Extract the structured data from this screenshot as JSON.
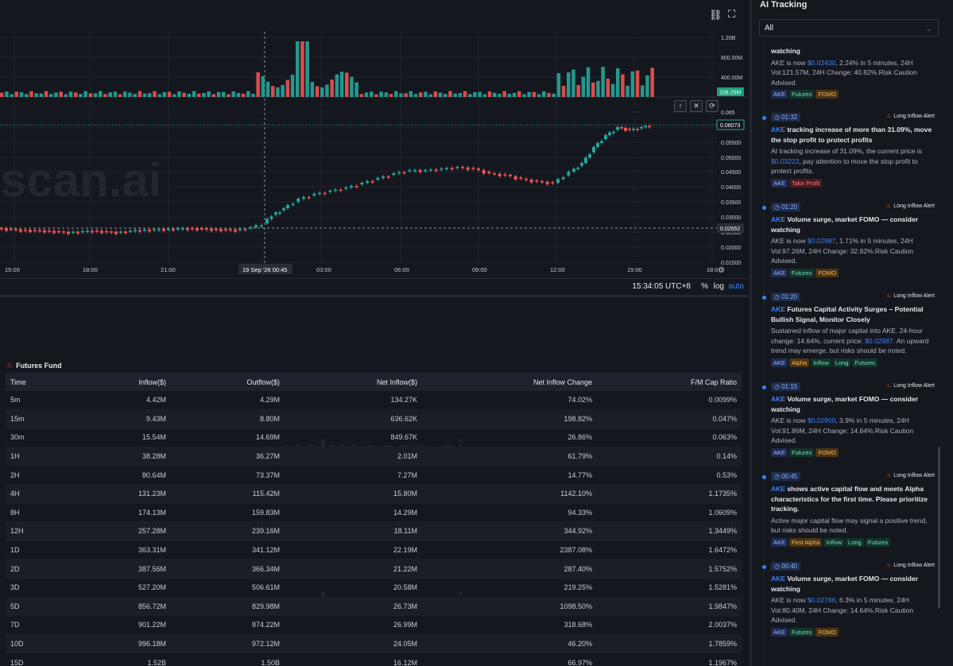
{
  "chart": {
    "volume_scale": [
      "1.20B",
      "800.00M",
      "400.00M"
    ],
    "volume_current": "108.25M",
    "price_scale": [
      "0.065",
      "0.05500",
      "0.05000",
      "0.04500",
      "0.04000",
      "0.03500",
      "0.03000",
      "0.02500",
      "0.02000",
      "0.01500"
    ],
    "last_price": "0.06073",
    "crosshair_price": "0.02652",
    "time_labels": [
      "15:00",
      "18:00",
      "21:00",
      "03:00",
      "06:00",
      "09:00",
      "12:00",
      "15:00",
      "18:0"
    ],
    "crosshair_time": "19 Sep '26   00:45",
    "clock": "15:34:05 UTC+8",
    "pct_label": "%",
    "log_label": "log",
    "auto_label": "auto",
    "watermark": "scan.ai",
    "colors": {
      "up": "#26a69a",
      "down": "#ef5350",
      "accent": "#3b82f6"
    }
  },
  "fund": {
    "title": "Futures Fund",
    "columns": [
      "Time",
      "Inflow($)",
      "Outflow($)",
      "Net Inflow($)",
      "Net Inflow Change",
      "F/M Cap Ratio"
    ],
    "watermark": "valuescan.ai",
    "rows": [
      {
        "time": "5m",
        "inflow": "4.42M",
        "outflow": "4.29M",
        "net": "134.27K",
        "change": "74.02%",
        "change_dir": "neg",
        "ratio": "0.0099%"
      },
      {
        "time": "15m",
        "inflow": "9.43M",
        "outflow": "8.80M",
        "net": "636.62K",
        "change": "198.82%",
        "change_dir": "pos",
        "ratio": "0.047%"
      },
      {
        "time": "30m",
        "inflow": "15.54M",
        "outflow": "14.69M",
        "net": "849.67K",
        "change": "26.86%",
        "change_dir": "neg",
        "ratio": "0.063%"
      },
      {
        "time": "1H",
        "inflow": "38.28M",
        "outflow": "36.27M",
        "net": "2.01M",
        "change": "61.79%",
        "change_dir": "neg",
        "ratio": "0.14%"
      },
      {
        "time": "2H",
        "inflow": "80.64M",
        "outflow": "73.37M",
        "net": "7.27M",
        "change": "14.77%",
        "change_dir": "neg",
        "ratio": "0.53%"
      },
      {
        "time": "4H",
        "inflow": "131.23M",
        "outflow": "115.42M",
        "net": "15.80M",
        "change": "1142.10%",
        "change_dir": "pos",
        "ratio": "1.1735%"
      },
      {
        "time": "8H",
        "inflow": "174.13M",
        "outflow": "159.83M",
        "net": "14.29M",
        "change": "94.33%",
        "change_dir": "pos",
        "ratio": "1.0609%"
      },
      {
        "time": "12H",
        "inflow": "257.28M",
        "outflow": "239.16M",
        "net": "18.11M",
        "change": "344.92%",
        "change_dir": "pos",
        "ratio": "1.3449%"
      },
      {
        "time": "1D",
        "inflow": "363.31M",
        "outflow": "341.12M",
        "net": "22.19M",
        "change": "2387.08%",
        "change_dir": "pos",
        "ratio": "1.6472%"
      },
      {
        "time": "2D",
        "inflow": "387.56M",
        "outflow": "366.34M",
        "net": "21.22M",
        "change": "287.40%",
        "change_dir": "pos",
        "ratio": "1.5752%"
      },
      {
        "time": "3D",
        "inflow": "527.20M",
        "outflow": "506.61M",
        "net": "20.58M",
        "change": "219.25%",
        "change_dir": "pos",
        "ratio": "1.5281%"
      },
      {
        "time": "5D",
        "inflow": "856.72M",
        "outflow": "829.98M",
        "net": "26.73M",
        "change": "1098.50%",
        "change_dir": "pos",
        "ratio": "1.9847%"
      },
      {
        "time": "7D",
        "inflow": "901.22M",
        "outflow": "874.22M",
        "net": "26.99M",
        "change": "318.68%",
        "change_dir": "pos",
        "ratio": "2.0037%"
      },
      {
        "time": "10D",
        "inflow": "996.18M",
        "outflow": "972.12M",
        "net": "24.05M",
        "change": "46.20%",
        "change_dir": "neg",
        "ratio": "1.7859%"
      },
      {
        "time": "15D",
        "inflow": "1.52B",
        "outflow": "1.50B",
        "net": "16.12M",
        "change": "66.97%",
        "change_dir": "neg",
        "ratio": "1.1967%"
      }
    ]
  },
  "ai_tracking": {
    "title": "AI Tracking",
    "filter_value": "All",
    "alerts": [
      {
        "time": "",
        "type": "",
        "coin": "",
        "headline": "watching",
        "body_pre": "AKE is now ",
        "price": "$0.03430",
        "body_post": ", 2.24% in 5 minutes, 24H Vol:121.57M, 24H Change: 40.82%.Risk Caution Advised.",
        "tags": [
          "AKE",
          "Futures",
          "FOMO"
        ]
      },
      {
        "time": "01:32",
        "type": "Long Inflow Alert",
        "coin": "AKE",
        "headline": " tracking increase of more than 31.09%, move the stop profit to protect profits",
        "body_pre": "AI tracking increase of 31.09%, the current price is ",
        "price": "$0.03222",
        "body_post": ", pay attention to move the stop profit to protect profits.",
        "tags": [
          "AKE",
          "Take Profit"
        ]
      },
      {
        "time": "01:20",
        "type": "Long Inflow Alert",
        "coin": "AKE",
        "headline": " Volume surge, market FOMO — consider watching",
        "body_pre": "AKE is now ",
        "price": "$0.02987",
        "body_post": ", 1.71% in 5 minutes, 24H Vol:97.26M, 24H Change: 32.92%.Risk Caution Advised.",
        "tags": [
          "AKE",
          "Futures",
          "FOMO"
        ]
      },
      {
        "time": "01:20",
        "type": "Long Inflow Alert",
        "coin": "AKE",
        "headline": " Futures Capital Activity Surges – Potential Bullish Signal, Monitor Closely",
        "body_pre": "Sustained inflow of major capital into AKE. 24-hour change: 14.64%, current price: ",
        "price": "$0.02987",
        "body_post": ". An upward trend may emerge, but risks should be noted.",
        "tags": [
          "AKE",
          "Alpha",
          "Inflow",
          "Long",
          "Futures"
        ]
      },
      {
        "time": "01:15",
        "type": "Long Inflow Alert",
        "coin": "AKE",
        "headline": " Volume surge, market FOMO — consider watching",
        "body_pre": "AKE is now ",
        "price": "$0.02900",
        "body_post": ", 3.9% in 5 minutes, 24H Vol:91.86M, 24H Change: 14.64%.Risk Caution Advised.",
        "tags": [
          "AKE",
          "Futures",
          "FOMO"
        ]
      },
      {
        "time": "00:45",
        "type": "Long Inflow Alert",
        "coin": "AKE",
        "headline": " shows active capital flow and meets Alpha characteristics for the first time. Please prioritize tracking.",
        "body_pre": "Active major capital flow may signal a positive trend, but risks should be noted.",
        "price": "",
        "body_post": "",
        "tags": [
          "AKE",
          "First Alpha",
          "Inflow",
          "Long",
          "Futures"
        ]
      },
      {
        "time": "00:40",
        "type": "Long Inflow Alert",
        "coin": "AKE",
        "headline": " Volume surge, market FOMO — consider watching",
        "body_pre": "AKE is now ",
        "price": "$0.02766",
        "body_post": ", 6.3% in 5 minutes, 24H Vol:80.40M, 24H Change: 14.64%.Risk Caution Advised.",
        "tags": [
          "AKE",
          "Futures",
          "FOMO"
        ]
      }
    ]
  }
}
